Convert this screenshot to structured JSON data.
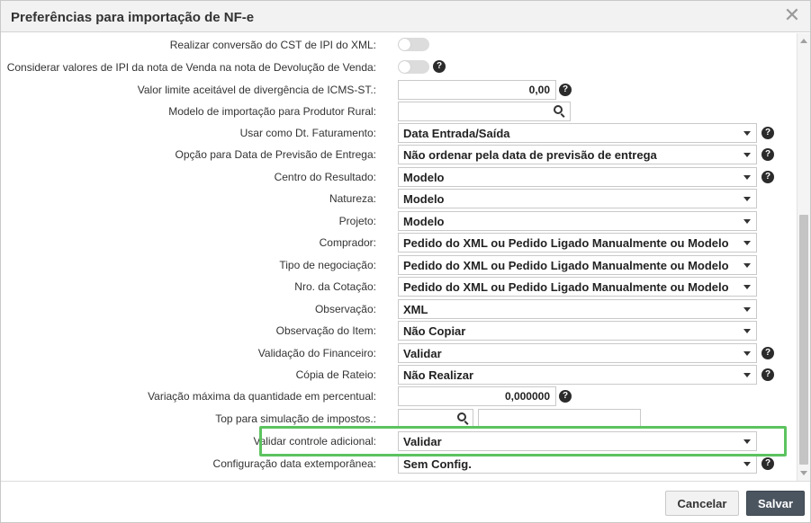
{
  "dialog": {
    "title": "Preferências para importação de NF-e",
    "close_glyph": "✕"
  },
  "fields": {
    "cst_ipi": {
      "label": "Realizar conversão do CST de IPI do XML:",
      "enabled": false
    },
    "ipi_devolucao": {
      "label": "Considerar valores de IPI da nota de Venda na nota de Devolução de Venda:",
      "enabled": false
    },
    "icms_st": {
      "label": "Valor limite aceitável de divergência de ICMS-ST.:",
      "value": "0,00"
    },
    "produtor_rural": {
      "label": "Modelo de importação para Produtor Rural:",
      "value": ""
    },
    "dt_faturamento": {
      "label": "Usar como Dt. Faturamento:",
      "value": "Data Entrada/Saída"
    },
    "previsao_entrega": {
      "label": "Opção para Data de Previsão de Entrega:",
      "value": "Não ordenar pela data de previsão de entrega"
    },
    "centro_resultado": {
      "label": "Centro do Resultado:",
      "value": "Modelo"
    },
    "natureza": {
      "label": "Natureza:",
      "value": "Modelo"
    },
    "projeto": {
      "label": "Projeto:",
      "value": "Modelo"
    },
    "comprador": {
      "label": "Comprador:",
      "value": "Pedido do XML ou Pedido Ligado Manualmente ou Modelo"
    },
    "tipo_negociacao": {
      "label": "Tipo de negociação:",
      "value": "Pedido do XML ou Pedido Ligado Manualmente ou Modelo"
    },
    "nro_cotacao": {
      "label": "Nro. da Cotação:",
      "value": "Pedido do XML ou Pedido Ligado Manualmente ou Modelo"
    },
    "observacao": {
      "label": "Observação:",
      "value": "XML"
    },
    "observacao_item": {
      "label": "Observação do Item:",
      "value": "Não Copiar"
    },
    "validacao_financeiro": {
      "label": "Validação do Financeiro:",
      "value": "Validar"
    },
    "copia_rateio": {
      "label": "Cópia de Rateio:",
      "value": "Não Realizar"
    },
    "variacao_quantidade": {
      "label": "Variação máxima da quantidade em percentual:",
      "value": "0,000000"
    },
    "top_simulacao": {
      "label": "Top para simulação de impostos.:",
      "code": "",
      "description": ""
    },
    "controle_adicional": {
      "label": "Validar controle adicional:",
      "value": "Validar"
    },
    "data_extemporanea": {
      "label": "Configuração data extemporânea:",
      "value": "Sem Config."
    }
  },
  "help_glyph": "?",
  "footer": {
    "cancel_label": "Cancelar",
    "save_label": "Salvar"
  },
  "colors": {
    "highlight": "#5cc35f",
    "save_button": "#4b5560"
  }
}
